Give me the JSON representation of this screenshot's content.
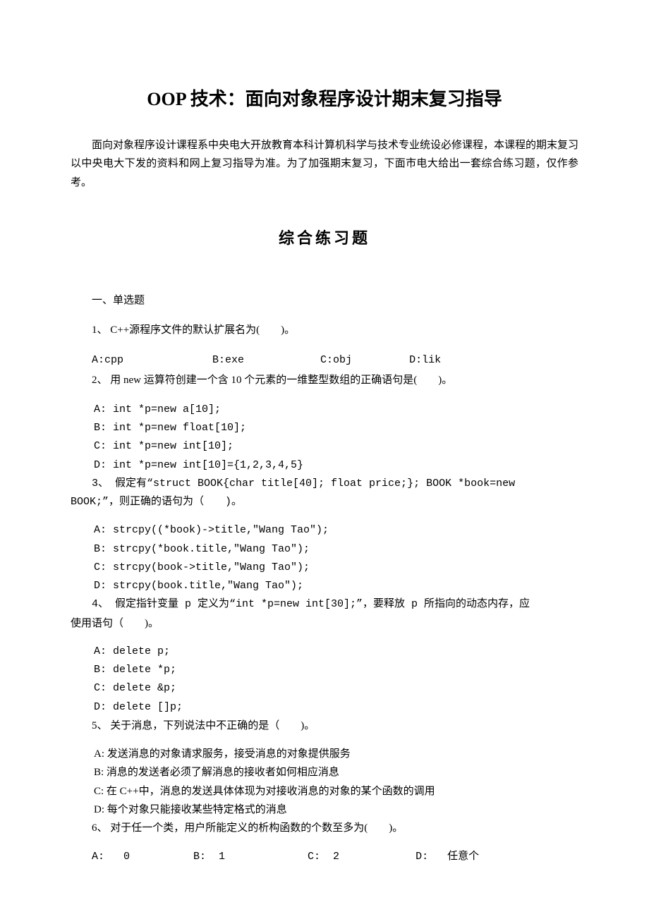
{
  "title": "OOP 技术：面向对象程序设计期末复习指导",
  "intro": "面向对象程序设计课程系中央电大开放教育本科计算机科学与技术专业统设必修课程，本课程的期末复习以中央电大下发的资料和网上复习指导为准。为了加强期末复习，下面市电大给出一套综合练习题，仅作参考。",
  "subtitle": "综合练习题",
  "section1_head": "一、单选题",
  "q1": {
    "stem": "1、 C++源程序文件的默认扩展名为(　　)。",
    "opts": "A:cpp              B:exe            C:obj         D:lik"
  },
  "q2": {
    "stem": "2、 用 new 运算符创建一个含 10 个元素的一维整型数组的正确语句是(　　)。",
    "a": " A: int *p=new a[10];",
    "b": " B: int *p=new float[10];",
    "c": " C: int *p=new int[10];",
    "d": " D: int *p=new int[10]={1,2,3,4,5}"
  },
  "q3": {
    "stem1": "3、 假定有“struct BOOK{char title[40]; float price;}; BOOK *book=new",
    "stem2": "BOOK;”，则正确的语句为（　　)。",
    "a": "A:    strcpy((*book)->title,\"Wang Tao\");",
    "b": "B:    strcpy(*book.title,\"Wang Tao\");",
    "c": "C:    strcpy(book->title,\"Wang Tao\");",
    "d": "D:    strcpy(book.title,\"Wang Tao\");"
  },
  "q4": {
    "stem1": "4、 假定指针变量 p 定义为“int *p=new int[30];”，要释放 p 所指向的动态内存，应",
    "stem2": "使用语句（　　)。",
    "a": "A:    delete p;",
    "b": "B:    delete *p;",
    "c": "C:    delete &p;",
    "d": "D:    delete []p;"
  },
  "q5": {
    "stem": "5、 关于消息，下列说法中不正确的是（　　)。",
    "a": "A:    发送消息的对象请求服务，接受消息的对象提供服务",
    "b": "B:    消息的发送者必须了解消息的接收者如何相应消息",
    "c": "C:    在 C++中，消息的发送具体体现为对接收消息的对象的某个函数的调用",
    "d": "D:    每个对象只能接收某些特定格式的消息"
  },
  "q6": {
    "stem": "6、 对于任一个类，用户所能定义的析构函数的个数至多为(　　)。",
    "opts": "A:   0          B:  1             C:  2            D:   任意个"
  }
}
